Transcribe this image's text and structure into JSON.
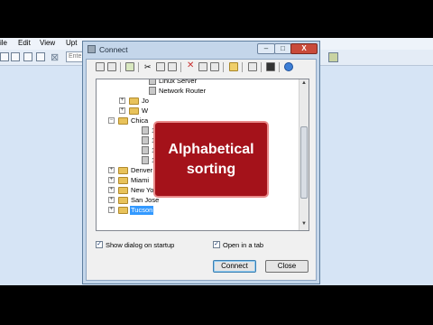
{
  "app": {
    "menu": [
      "ile",
      "Edit",
      "View",
      "Upt"
    ],
    "entry_text": "Ente"
  },
  "dialog": {
    "title": "Connect",
    "min_symbol": "–",
    "max_symbol": "□",
    "close_symbol": "X",
    "toolbar_icons": [
      "connect-icon",
      "new-session-icon",
      "cut-icon",
      "copy-icon",
      "paste-icon",
      "delete-icon",
      "properties-icon",
      "find-icon",
      "new-folder-icon",
      "lock-icon",
      "help-icon"
    ],
    "tree": {
      "rows": [
        {
          "label": "Linux Server",
          "type": "server",
          "expander": ""
        },
        {
          "label": "Network Router",
          "type": "server",
          "expander": ""
        },
        {
          "label": "Jo",
          "type": "folder",
          "expander": "+"
        },
        {
          "label": "W",
          "type": "folder",
          "expander": "+"
        },
        {
          "label": "Chica",
          "type": "folder",
          "expander": "−"
        },
        {
          "label": "1",
          "type": "server",
          "expander": ""
        },
        {
          "label": "1",
          "type": "server",
          "expander": ""
        },
        {
          "label": "1",
          "type": "server",
          "expander": ""
        },
        {
          "label": "1",
          "type": "server",
          "expander": ""
        },
        {
          "label": "Denver",
          "type": "folder",
          "expander": "+"
        },
        {
          "label": "Miami",
          "type": "folder",
          "expander": "+"
        },
        {
          "label": "New York City",
          "type": "folder",
          "expander": "+"
        },
        {
          "label": "San Jose",
          "type": "folder",
          "expander": "+"
        },
        {
          "label": "Tucson",
          "type": "folder",
          "expander": "+",
          "selected": true
        }
      ]
    },
    "overlay": {
      "line1": "Alphabetical",
      "line2": "sorting"
    },
    "show_dialog_on_startup": {
      "label": "Show dialog on startup",
      "checked": true
    },
    "open_in_tab": {
      "label": "Open in a tab",
      "checked": true
    },
    "connect_label": "Connect",
    "close_label": "Close",
    "check_mark": "✓"
  }
}
